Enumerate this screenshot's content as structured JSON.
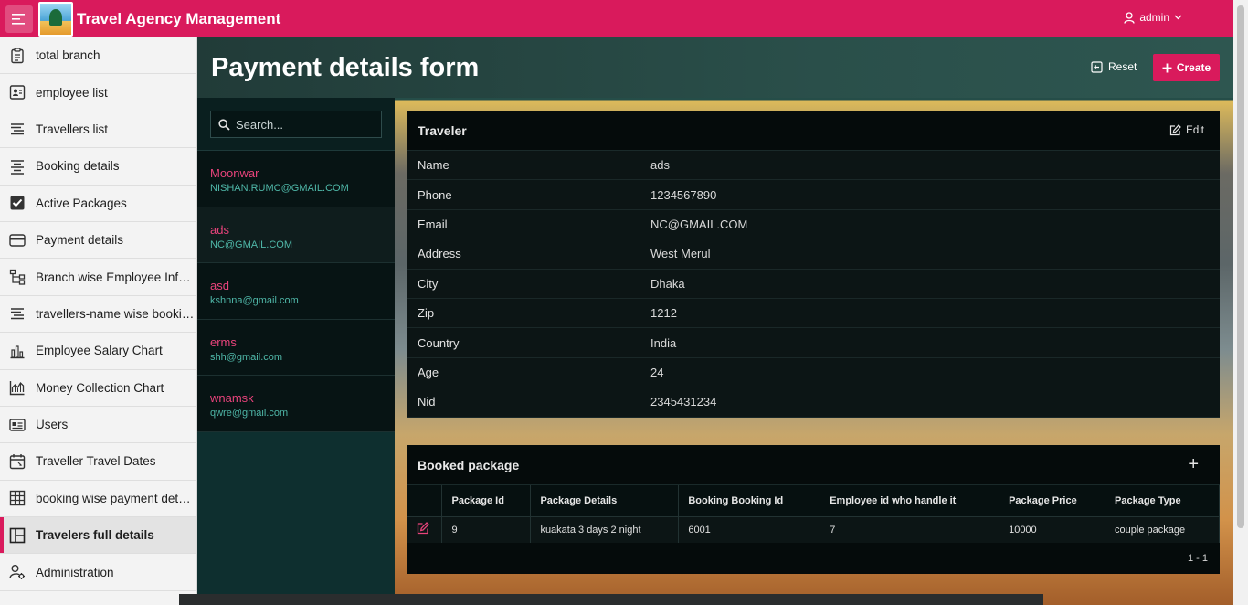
{
  "app": {
    "title": "Travel Agency Management",
    "user": "admin"
  },
  "sidebar": {
    "items": [
      {
        "label": "total branch",
        "icon": "clipboard-icon"
      },
      {
        "label": "employee list",
        "icon": "contact-card-icon"
      },
      {
        "label": "Travellers list",
        "icon": "list-lines-icon"
      },
      {
        "label": "Booking details",
        "icon": "align-center-icon"
      },
      {
        "label": "Active Packages",
        "icon": "checkbox-icon"
      },
      {
        "label": "Payment details",
        "icon": "credit-card-icon"
      },
      {
        "label": "Branch wise Employee Inform...",
        "icon": "hierarchy-icon"
      },
      {
        "label": "travellers-name wise booking ...",
        "icon": "list-lines-icon"
      },
      {
        "label": "Employee Salary Chart",
        "icon": "bar-chart-icon"
      },
      {
        "label": "Money Collection Chart",
        "icon": "area-chart-icon"
      },
      {
        "label": "Users",
        "icon": "id-card-icon"
      },
      {
        "label": "Traveller Travel Dates",
        "icon": "calendar-icon"
      },
      {
        "label": "booking wise payment details",
        "icon": "table-icon"
      },
      {
        "label": "Travelers full details",
        "icon": "layout-icon",
        "active": true
      },
      {
        "label": "Administration",
        "icon": "user-gear-icon"
      }
    ]
  },
  "page": {
    "title": "Payment details form",
    "reset_label": "Reset",
    "create_label": "Create"
  },
  "search": {
    "placeholder": "Search..."
  },
  "records": [
    {
      "name": "Moonwar",
      "email": "NISHAN.RUMC@GMAIL.COM"
    },
    {
      "name": "ads",
      "email": "NC@GMAIL.COM",
      "selected": true
    },
    {
      "name": "asd",
      "email": "kshnna@gmail.com"
    },
    {
      "name": "erms",
      "email": "shh@gmail.com"
    },
    {
      "name": "wnamsk",
      "email": "qwre@gmail.com"
    }
  ],
  "traveler": {
    "title": "Traveler",
    "edit_label": "Edit",
    "fields": [
      {
        "label": "Name",
        "value": "ads"
      },
      {
        "label": "Phone",
        "value": "1234567890"
      },
      {
        "label": "Email",
        "value": "NC@GMAIL.COM"
      },
      {
        "label": "Address",
        "value": "West Merul"
      },
      {
        "label": "City",
        "value": "Dhaka"
      },
      {
        "label": "Zip",
        "value": "1212"
      },
      {
        "label": "Country",
        "value": "India"
      },
      {
        "label": "Age",
        "value": "24"
      },
      {
        "label": "Nid",
        "value": "2345431234"
      }
    ]
  },
  "booked_package": {
    "title": "Booked package",
    "add_label": "+",
    "columns": [
      "Package Id",
      "Package Details",
      "Booking Booking Id",
      "Employee id who handle it",
      "Package Price",
      "Package Type"
    ],
    "rows": [
      [
        "9",
        "kuakata 3 days 2 night",
        "6001",
        "7",
        "10000",
        "couple package"
      ]
    ],
    "pagination": "1 - 1"
  },
  "colors": {
    "accent": "#d91a5c",
    "record_name": "#e8437b",
    "record_email": "#4fb7a8"
  }
}
